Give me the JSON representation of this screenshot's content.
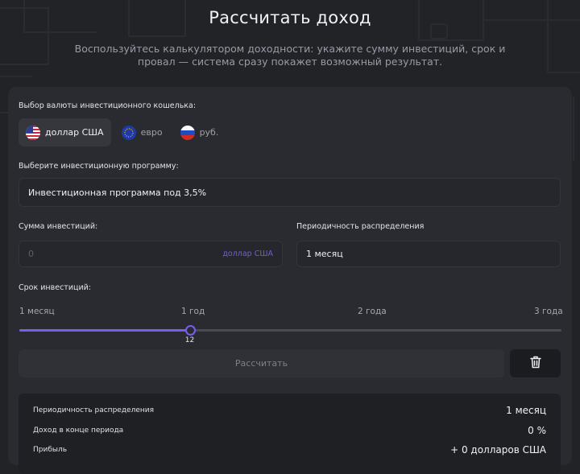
{
  "header": {
    "title": "Рассчитать доход",
    "subtitle": "Воспользуйтесь калькулятором доходности: укажите сумму инвестиций, срок и провал — система сразу покажет возможный результат."
  },
  "currency": {
    "label": "Выбор валюты инвестиционного кошелька:",
    "options": [
      {
        "label": "доллар США",
        "icon": "us-flag-icon",
        "active": true
      },
      {
        "label": "евро",
        "icon": "eu-flag-icon",
        "active": false
      },
      {
        "label": "руб.",
        "icon": "ru-flag-icon",
        "active": false
      }
    ]
  },
  "program": {
    "label": "Выберите инвестиционную программу:",
    "value": "Инвестиционная программа под 3,5%"
  },
  "amount": {
    "label": "Сумма инвестиций:",
    "placeholder": "0",
    "suffix": "доллар США"
  },
  "period": {
    "label": "Периодичность распределения",
    "value": "1 месяц"
  },
  "term": {
    "label": "Срок инвестиций:",
    "ticks": [
      "1 месяц",
      "1 год",
      "2 года",
      "3 года"
    ],
    "min": 1,
    "max": 36,
    "value": 12,
    "value_label": "12"
  },
  "actions": {
    "calculate_label": "Рассчитать",
    "delete_icon": "trash-icon"
  },
  "results": {
    "rows": [
      {
        "label": "Периодичность распределения",
        "value": "1 месяц"
      },
      {
        "label": "Доход в конце периода",
        "value": "0 %"
      },
      {
        "label": "Прибыль",
        "value": "+ 0 долларов США"
      }
    ]
  },
  "colors": {
    "background": "#222327",
    "card": "#2a2b30",
    "accent": "#7a5cf0"
  }
}
